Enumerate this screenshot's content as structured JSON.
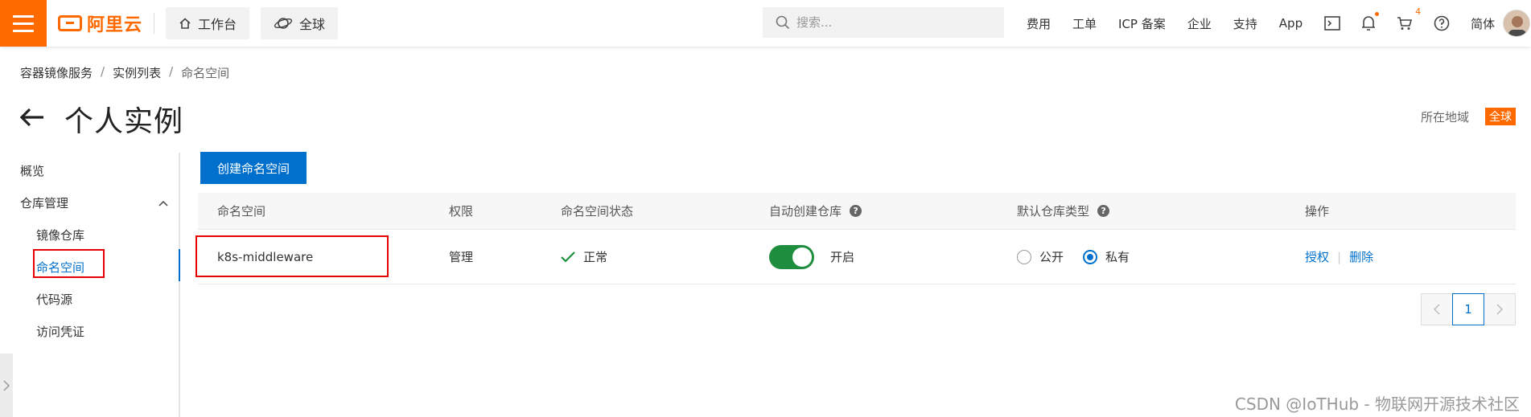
{
  "topbar": {
    "logo_text": "阿里云",
    "workbench_label": "工作台",
    "region_label": "全球",
    "search_placeholder": "搜索...",
    "links": [
      "费用",
      "工单",
      "ICP 备案",
      "企业",
      "支持",
      "App"
    ],
    "cart_count": "4",
    "language_label": "简体",
    "icons": [
      "terminal-icon",
      "bell-icon",
      "cart-icon",
      "help-icon"
    ]
  },
  "breadcrumb": [
    "容器镜像服务",
    "实例列表",
    "命名空间"
  ],
  "page": {
    "title": "个人实例",
    "region_label": "所在地域",
    "region_value": "全球"
  },
  "sidebar": {
    "overview": "概览",
    "repo_mgmt": "仓库管理",
    "items": [
      "镜像仓库",
      "命名空间",
      "代码源",
      "访问凭证"
    ],
    "active": "命名空间"
  },
  "main": {
    "create_button": "创建命名空间",
    "columns": [
      "命名空间",
      "权限",
      "命名空间状态",
      "自动创建仓库",
      "默认仓库类型",
      "操作"
    ],
    "rows": [
      {
        "namespace": "k8s-middleware",
        "permission": "管理",
        "status": "正常",
        "auto_create_on": true,
        "auto_create_label": "开启",
        "repo_type_options": [
          "公开",
          "私有"
        ],
        "repo_type_selected": "私有",
        "actions": [
          "授权",
          "删除"
        ]
      }
    ],
    "pagination": {
      "current": "1"
    }
  },
  "colors": {
    "brand_orange": "#ff6a00",
    "primary_blue": "#0070cc",
    "switch_green": "#1e8e3e",
    "highlight_red": "#e60000"
  },
  "watermark": "CSDN @IoTHub - 物联网开源技术社区"
}
